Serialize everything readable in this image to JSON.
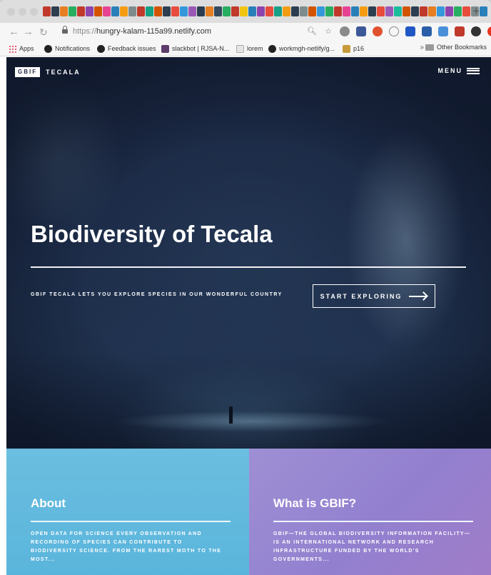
{
  "browser": {
    "new_tab_symbol": "+",
    "url_scheme": "https://",
    "url_host": "hungry-kalam-115a99.netlify.com",
    "tab_icon_colors": [
      "#c0392b",
      "#2c3e50",
      "#e67e22",
      "#27ae60",
      "#c0392b",
      "#8e44ad",
      "#d35400",
      "#e84393",
      "#2980b9",
      "#f39c12",
      "#7f8c8d",
      "#c0392b",
      "#16a085",
      "#d35400",
      "#2c3e50",
      "#e74c3c",
      "#3498db",
      "#9b59b6",
      "#2c3e50",
      "#e67e22",
      "#34495e",
      "#27ae60",
      "#c0392b",
      "#f1c40f",
      "#2980b9",
      "#8e44ad",
      "#e74c3c",
      "#16a085",
      "#f39c12",
      "#2c3e50",
      "#7f8c8d",
      "#d35400",
      "#3498db",
      "#27ae60",
      "#c0392b",
      "#e84393",
      "#2980b9",
      "#f39c12",
      "#2c3e50",
      "#e74c3c",
      "#9b59b6",
      "#1abc9c",
      "#d35400",
      "#2c3e50",
      "#c0392b",
      "#e67e22",
      "#3498db",
      "#8e44ad",
      "#27ae60",
      "#e74c3c",
      "#7f8c8d",
      "#2980b9"
    ]
  },
  "bookmarks": {
    "items": [
      {
        "label": "Apps",
        "icon": "apps-grid-icon"
      },
      {
        "label": "Notifications",
        "icon": "github-icon"
      },
      {
        "label": "Feedback issues",
        "icon": "github-icon"
      },
      {
        "label": "slackbot | RJSA-N...",
        "icon": "slack-icon"
      },
      {
        "label": "lorem",
        "icon": "page-icon"
      },
      {
        "label": "workmgh-netlify/g...",
        "icon": "github-icon"
      },
      {
        "label": "p16",
        "icon": "image-icon"
      }
    ],
    "more": "»",
    "other": "Other Bookmarks"
  },
  "site": {
    "brand_box": "GBIF",
    "brand_name": "TECALA",
    "menu_label": "MENU",
    "hero_title": "Biodiversity of Tecala",
    "hero_tagline": "GBIF TECALA LETS YOU EXPLORE SPECIES IN OUR WONDERFUL COUNTRY",
    "cta_label": "START EXPLORING"
  },
  "cards": {
    "about": {
      "title": "About",
      "text": "OPEN DATA FOR SCIENCE EVERY OBSERVATION AND RECORDING OF SPECIES CAN CONTRIBUTE TO BIODIVERSITY SCIENCE. FROM THE RAREST MOTH TO THE MOST...",
      "color": "#62bade"
    },
    "gbif": {
      "title": "What is GBIF?",
      "text": "GBIF—THE GLOBAL BIODIVERSITY INFORMATION FACILITY—IS AN INTERNATIONAL NETWORK AND RESEARCH INFRASTRUCTURE FUNDED BY THE WORLD'S GOVERNMENTS...",
      "color": "#9787d2"
    }
  }
}
